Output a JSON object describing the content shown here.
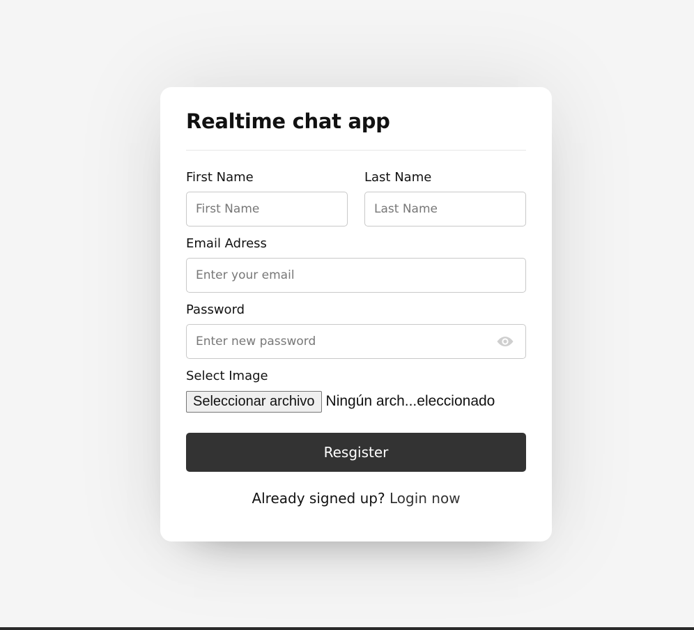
{
  "form": {
    "title": "Realtime chat app",
    "first_name": {
      "label": "First Name",
      "placeholder": "First Name",
      "value": ""
    },
    "last_name": {
      "label": "Last Name",
      "placeholder": "Last Name",
      "value": ""
    },
    "email": {
      "label": "Email Adress",
      "placeholder": "Enter your email",
      "value": ""
    },
    "password": {
      "label": "Password",
      "placeholder": "Enter new password",
      "value": "",
      "toggle_icon": "eye-icon"
    },
    "image": {
      "label": "Select Image",
      "button_label": "Seleccionar archivo",
      "status": "Ningún arch...eleccionado"
    },
    "submit_label": "Resgister",
    "footer_text": "Already signed up?",
    "footer_link": "Login now"
  },
  "colors": {
    "background": "#f5f5f5",
    "card": "#ffffff",
    "button": "#333333",
    "button_text": "#ffffff"
  }
}
